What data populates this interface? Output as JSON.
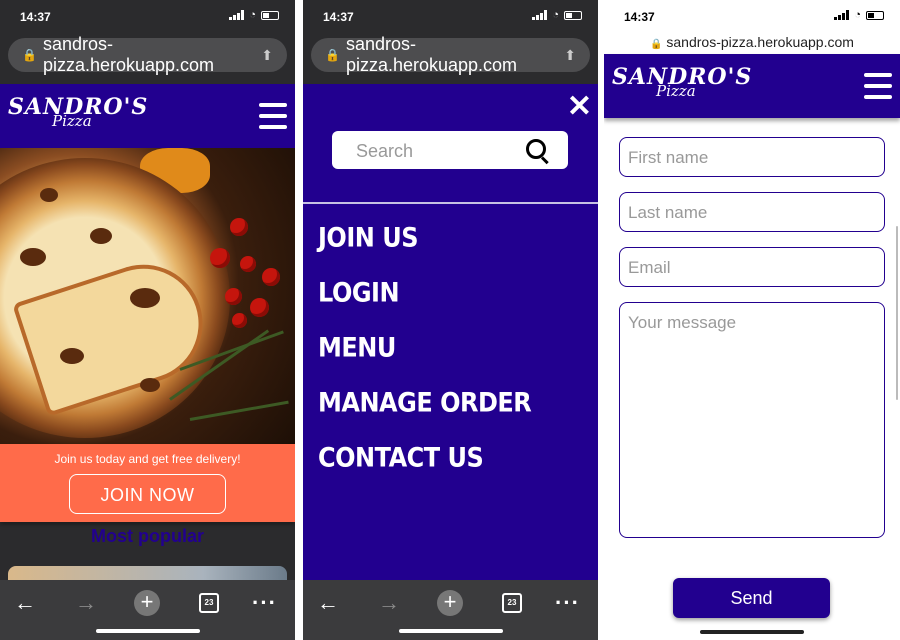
{
  "panel1": {
    "status": {
      "time": "14:37"
    },
    "url": "sandros-pizza.herokuapp.com",
    "logo": {
      "line1": "SANDRO'S",
      "line2": "Pizza"
    },
    "promo": {
      "text": "Join us today and get free delivery!",
      "button": "JOIN NOW"
    },
    "section_title": "Most popular"
  },
  "panel2": {
    "status": {
      "time": "14:37"
    },
    "url": "sandros-pizza.herokuapp.com",
    "search": {
      "placeholder": "Search"
    },
    "menu_items": [
      "JOIN US",
      "LOGIN",
      "MENU",
      "MANAGE ORDER",
      "CONTACT US"
    ]
  },
  "panel3": {
    "status": {
      "time": "14:37"
    },
    "url": "sandros-pizza.herokuapp.com",
    "logo": {
      "line1": "SANDRO'S",
      "line2": "Pizza"
    },
    "form": {
      "first_name": "First name",
      "last_name": "Last name",
      "email": "Email",
      "message": "Your message",
      "send": "Send"
    }
  },
  "browser_nav": {
    "tab_count": "23"
  },
  "colors": {
    "brand": "#22008f",
    "promo": "#ff6b4a"
  },
  "icons": [
    "lock-icon",
    "share-icon",
    "hamburger-icon",
    "close-icon",
    "search-icon",
    "back-arrow-icon",
    "forward-arrow-icon",
    "new-tab-icon",
    "tabs-icon",
    "more-icon"
  ]
}
